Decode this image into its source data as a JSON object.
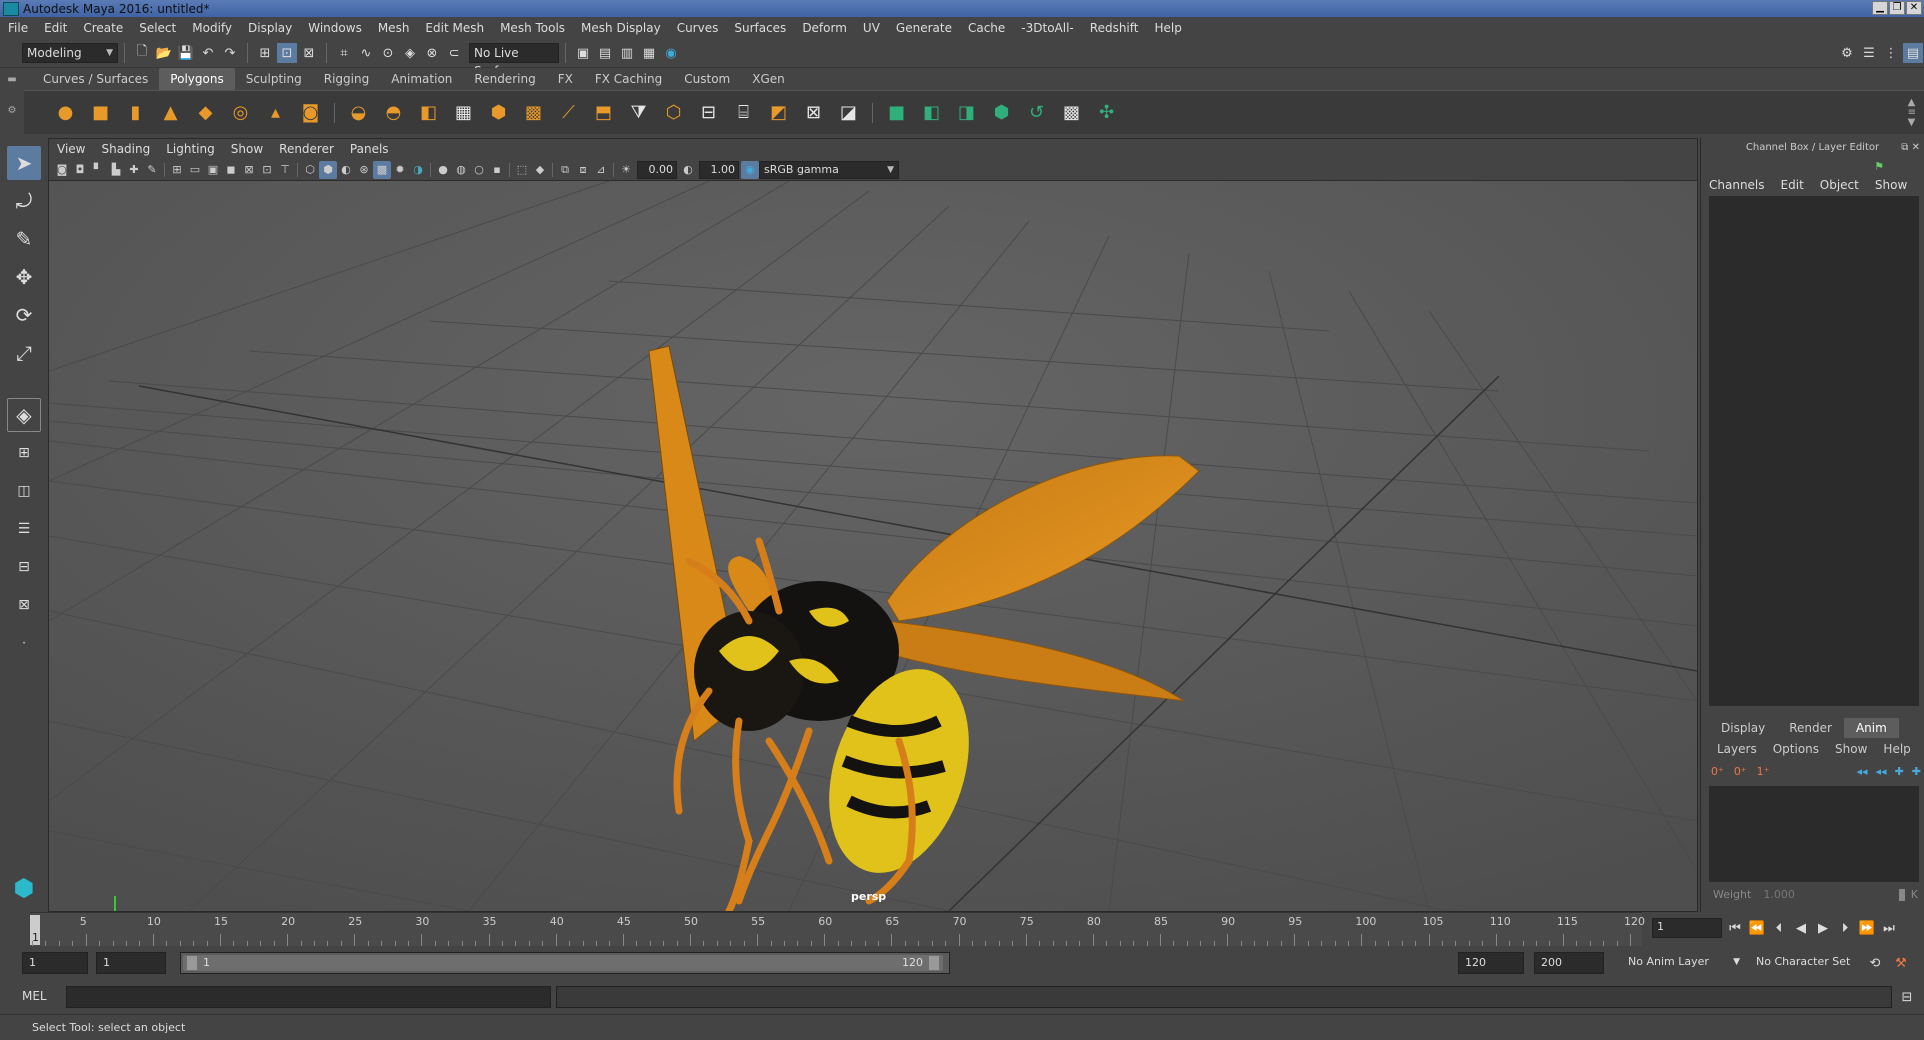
{
  "window": {
    "title": "Autodesk Maya 2016: untitled*",
    "minimize": "▁",
    "restore": "❐",
    "close": "✕"
  },
  "menus": [
    "File",
    "Edit",
    "Create",
    "Select",
    "Modify",
    "Display",
    "Windows",
    "Mesh",
    "Edit Mesh",
    "Mesh Tools",
    "Mesh Display",
    "Curves",
    "Surfaces",
    "Deform",
    "UV",
    "Generate",
    "Cache",
    "-3DtoAll-",
    "Redshift",
    "Help"
  ],
  "statusline": {
    "workspace": "Modeling",
    "live_surface": "No Live Surface"
  },
  "shelf": {
    "tabs": [
      "Curves / Surfaces",
      "Polygons",
      "Sculpting",
      "Rigging",
      "Animation",
      "Rendering",
      "FX",
      "FX Caching",
      "Custom",
      "XGen"
    ],
    "active_tab": "Polygons"
  },
  "panel": {
    "menus": [
      "View",
      "Shading",
      "Lighting",
      "Show",
      "Renderer",
      "Panels"
    ],
    "exposure": "0.00",
    "gamma": "1.00",
    "color_space": "sRGB gamma"
  },
  "viewport": {
    "camera": "persp"
  },
  "channelbox": {
    "title": "Channel Box / Layer Editor",
    "menus": [
      "Channels",
      "Edit",
      "Object",
      "Show"
    ]
  },
  "layer_editor": {
    "tabs": [
      "Display",
      "Render",
      "Anim"
    ],
    "active_tab": "Anim",
    "menus": [
      "Layers",
      "Options",
      "Show",
      "Help"
    ],
    "weight_label": "Weight",
    "weight_value": "1.000",
    "k_label": "K"
  },
  "timeline": {
    "ticks": [
      "5",
      "10",
      "15",
      "20",
      "25",
      "30",
      "35",
      "40",
      "45",
      "50",
      "55",
      "60",
      "65",
      "70",
      "75",
      "80",
      "85",
      "90",
      "95",
      "100",
      "105",
      "110",
      "115",
      "120"
    ],
    "start_label": "1",
    "current_frame": "1"
  },
  "range": {
    "start": "1",
    "playback_start": "1",
    "slider_start": "1",
    "slider_end": "120",
    "playback_end": "120",
    "end": "200",
    "anim_layer": "No Anim Layer",
    "character_set": "No Character Set"
  },
  "cmdline": {
    "lang": "MEL"
  },
  "help": {
    "text": "Select Tool: select an object"
  }
}
